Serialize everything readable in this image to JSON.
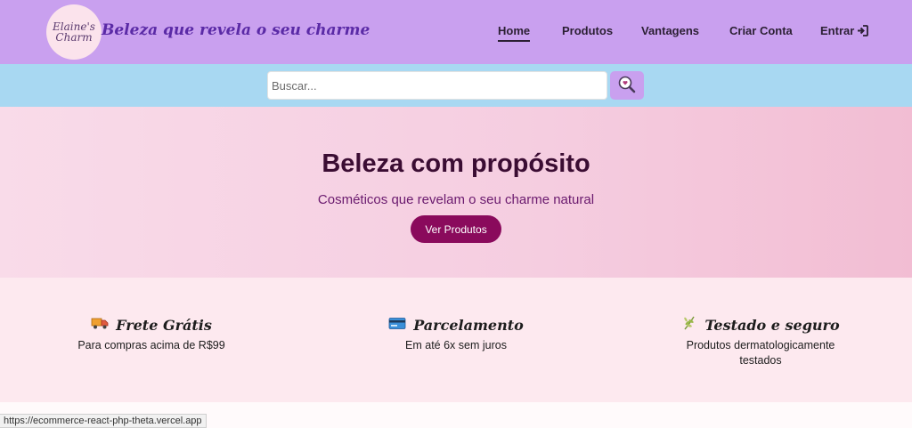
{
  "header": {
    "logo_line1": "Elaine's",
    "logo_line2": "Charm",
    "tagline": "Beleza que revela o seu charme",
    "nav": {
      "home": "Home",
      "produtos": "Produtos",
      "vantagens": "Vantagens",
      "criar_conta": "Criar Conta",
      "entrar": "Entrar"
    },
    "colors": {
      "background": "#c9a0ef",
      "tagline": "#5a2aa6"
    }
  },
  "search": {
    "placeholder": "Buscar...",
    "value": "",
    "button_icon": "search-icon",
    "bar_color": "#a8d8f2"
  },
  "hero": {
    "title": "Beleza com propósito",
    "subtitle": "Cosméticos que revelam o seu charme natural",
    "button_label": "Ver Produtos",
    "button_color": "#8a0a5c"
  },
  "features": [
    {
      "icon": "truck-icon",
      "title": "Frete Grátis",
      "desc": "Para compras acima de R$99"
    },
    {
      "icon": "credit-card-icon",
      "title": "Parcelamento",
      "desc": "Em até 6x sem juros"
    },
    {
      "icon": "herb-icon",
      "title": "Testado e seguro",
      "desc": "Produtos dermatologicamente testados"
    }
  ],
  "status_bar": {
    "url": "https://ecommerce-react-php-theta.vercel.app"
  }
}
